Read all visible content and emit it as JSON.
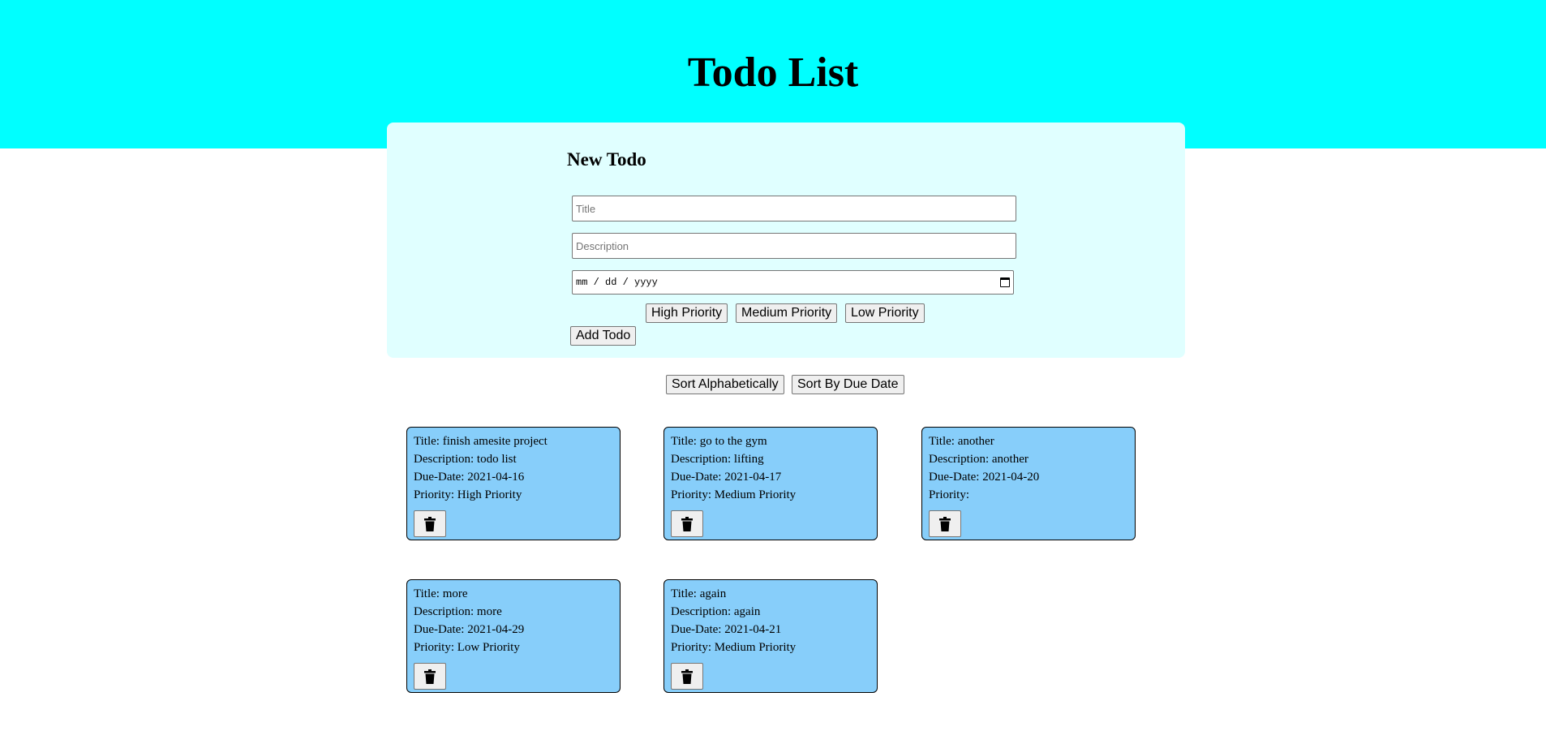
{
  "header": {
    "title": "Todo List",
    "band_color": "#00ffff"
  },
  "form": {
    "heading": "New Todo",
    "title_placeholder": "Title",
    "description_placeholder": "Description",
    "date_placeholder": "mm / dd / yyyy",
    "priority_buttons": {
      "high": "High Priority",
      "medium": "Medium Priority",
      "low": "Low Priority"
    },
    "add_button": "Add Todo",
    "panel_color": "#e0ffff"
  },
  "sort": {
    "alphabetical": "Sort Alphabetically",
    "due_date": "Sort By Due Date"
  },
  "todos": [
    {
      "title": "Title: finish amesite project",
      "description": "Description: todo list",
      "due": "Due-Date: 2021-04-16",
      "priority": "Priority: High Priority",
      "delete_icon": "trash-icon"
    },
    {
      "title": "Title: go to the gym",
      "description": "Description: lifting",
      "due": "Due-Date: 2021-04-17",
      "priority": "Priority: Medium Priority",
      "delete_icon": "trash-icon"
    },
    {
      "title": "Title: another",
      "description": "Description: another",
      "due": "Due-Date: 2021-04-20",
      "priority": "Priority:",
      "delete_icon": "trash-icon"
    },
    {
      "title": "Title: more",
      "description": "Description: more",
      "due": "Due-Date: 2021-04-29",
      "priority": "Priority: Low Priority",
      "delete_icon": "trash-icon"
    },
    {
      "title": "Title: again",
      "description": "Description: again",
      "due": "Due-Date: 2021-04-21",
      "priority": "Priority: Medium Priority",
      "delete_icon": "trash-icon"
    }
  ],
  "colors": {
    "card": "#87cefa",
    "button": "#efefef"
  }
}
